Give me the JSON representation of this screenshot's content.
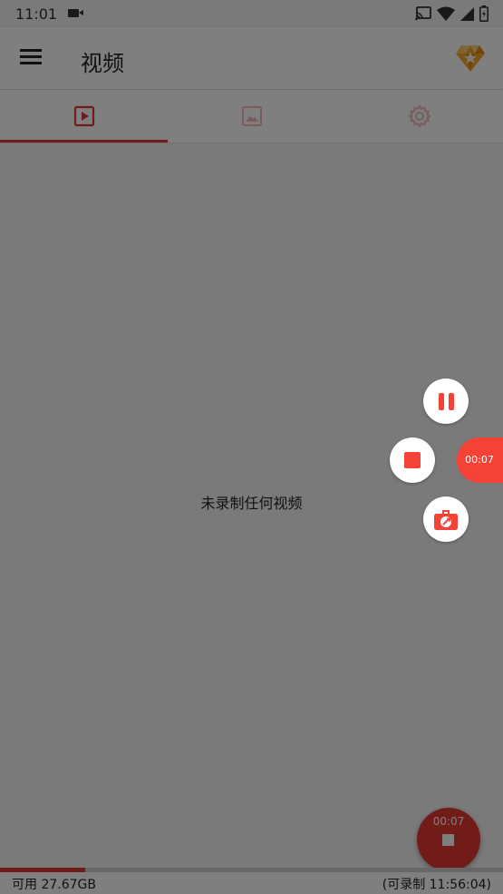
{
  "status_bar": {
    "time": "11:01",
    "icons": [
      "video-camera-icon",
      "cast-icon",
      "wifi-icon",
      "signal-icon",
      "battery-icon"
    ]
  },
  "app_bar": {
    "title": "视频",
    "icons": [
      "menu-icon",
      "gem-icon"
    ]
  },
  "tabs": [
    {
      "icon": "video-icon",
      "active": true
    },
    {
      "icon": "image-icon",
      "active": false
    },
    {
      "icon": "gear-icon",
      "active": false
    }
  ],
  "main": {
    "empty_message": "未录制任何视频"
  },
  "floating_controls": {
    "timer": "00:07",
    "buttons": [
      "pause-icon",
      "stop-icon",
      "toolbox-icon"
    ]
  },
  "fab": {
    "time": "00:07",
    "icon": "stop-icon"
  },
  "bottom_bar": {
    "available": "可用 27.67GB",
    "remaining": "(可录制 11:56:04)",
    "storage_used_fraction": 0.17
  },
  "colors": {
    "accent": "#e53935",
    "float_accent": "#f44336",
    "overlay": "rgba(0,0,0,0.5)"
  }
}
